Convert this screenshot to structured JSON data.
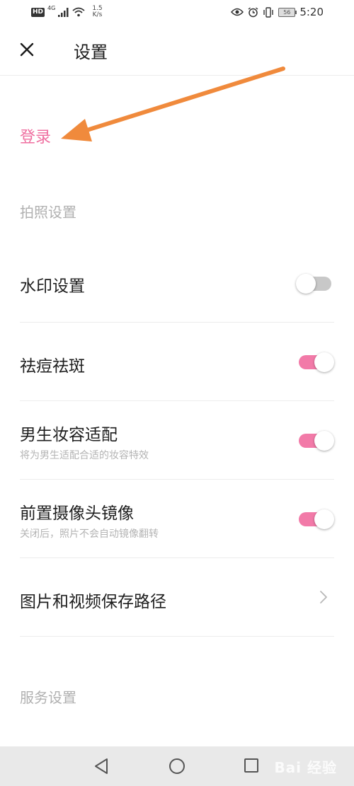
{
  "status_bar": {
    "hd_badge": "HD",
    "network": "4G",
    "speed_value": "1.5",
    "speed_unit": "K/s",
    "battery": "56",
    "time": "5:20"
  },
  "header": {
    "title": "设置"
  },
  "login": {
    "label": "登录",
    "annotation_arrow_color": "#f08a3c"
  },
  "sections": [
    {
      "header": "拍照设置"
    },
    {
      "header": "服务设置"
    }
  ],
  "settings": [
    {
      "title": "水印设置",
      "subtitle": "",
      "control": "toggle",
      "enabled": false
    },
    {
      "title": "祛痘祛斑",
      "subtitle": "",
      "control": "toggle",
      "enabled": true
    },
    {
      "title": "男生妆容适配",
      "subtitle": "将为男生适配合适的妆容特效",
      "control": "toggle",
      "enabled": true
    },
    {
      "title": "前置摄像头镜像",
      "subtitle": "关闭后，照片不会自动镜像翻转",
      "control": "toggle",
      "enabled": true
    },
    {
      "title": "图片和视频保存路径",
      "subtitle": "",
      "control": "chevron"
    }
  ],
  "nav_bar": {
    "watermark": "Bai 经验"
  },
  "colors": {
    "accent": "#ef6fa0",
    "toggle_on": "#f27aa8",
    "toggle_off": "#c8c8c8",
    "section_header": "#b0b0b0"
  }
}
